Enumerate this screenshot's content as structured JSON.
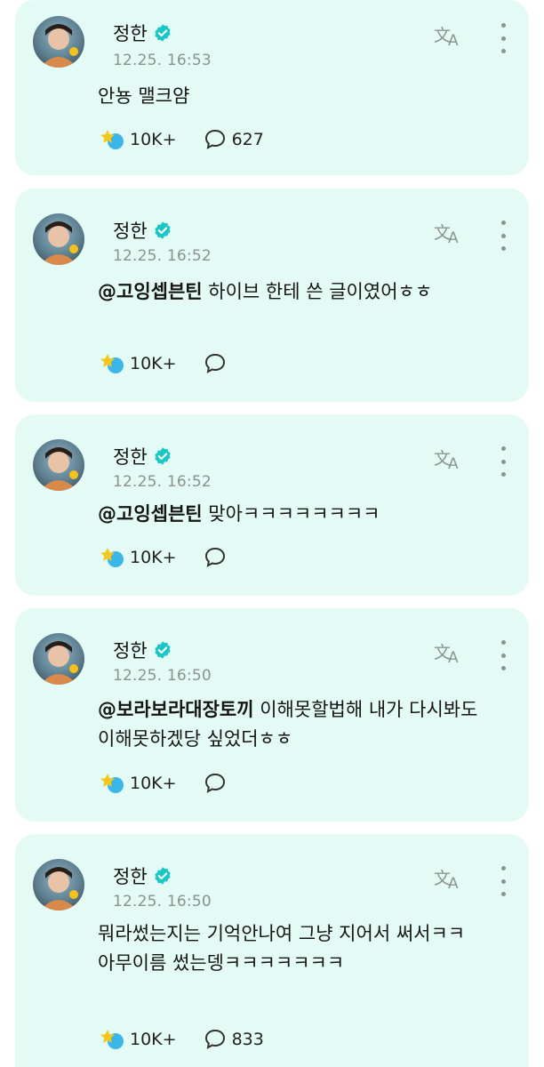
{
  "posts": [
    {
      "author": "정한",
      "time": "12.25. 16:53",
      "mention": "",
      "text": "안뇽 맬크얌",
      "likes": "10K+",
      "comments": "627"
    },
    {
      "author": "정한",
      "time": "12.25. 16:52",
      "mention": "@고잉셉븐틴",
      "text": " 하이브 한테 쓴 글이였어ㅎㅎ",
      "likes": "10K+",
      "comments": ""
    },
    {
      "author": "정한",
      "time": "12.25. 16:52",
      "mention": "@고잉셉븐틴",
      "text": " 맞아ㅋㅋㅋㅋㅋㅋㅋㅋ",
      "likes": "10K+",
      "comments": ""
    },
    {
      "author": "정한",
      "time": "12.25. 16:50",
      "mention": "@보라보라대장토끼",
      "text": " 이해못할법해 내가 다시봐도 이해못하겠당 싶었더ㅎㅎ",
      "likes": "10K+",
      "comments": ""
    },
    {
      "author": "정한",
      "time": "12.25. 16:50",
      "mention": "",
      "text": "뭐라썼는지는 기억안나여 그냥 지어서 써서ㅋㅋ\n아무이름 썼는뎅ㅋㅋㅋㅋㅋㅋㅋ",
      "likes": "10K+",
      "comments": "833"
    }
  ],
  "icons": {
    "verified": "verified-badge-icon",
    "translate": "translate-icon",
    "more": "more-vertical-icon",
    "like": "like-star-icon",
    "comment": "comment-bubble-icon"
  },
  "colors": {
    "card_bg": "#e3faf5",
    "verified": "#19c7c7",
    "muted": "#8a9390"
  }
}
